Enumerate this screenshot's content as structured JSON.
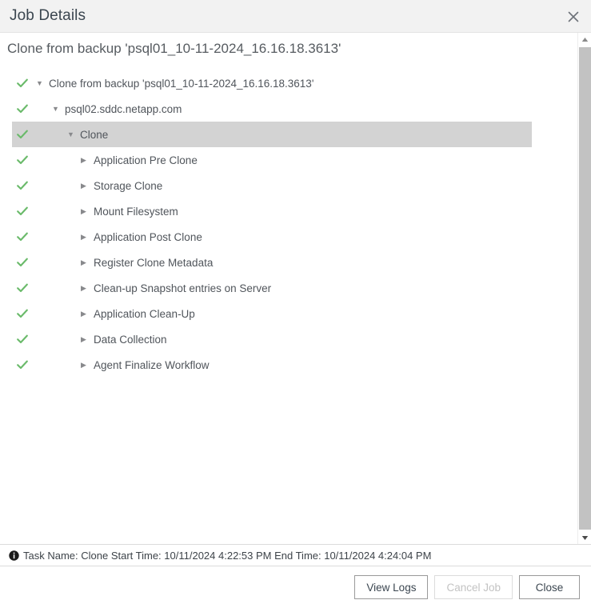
{
  "window": {
    "title": "Job Details",
    "close_icon": "close-icon"
  },
  "heading": "Clone from backup 'psql01_10-11-2024_16.16.18.3613'",
  "tree": {
    "nodes": [
      {
        "label": "Clone from backup 'psql01_10-11-2024_16.16.18.3613'",
        "level": 0,
        "twisty": "▼",
        "expanded": true,
        "status": "success",
        "selected": false
      },
      {
        "label": "psql02.sddc.netapp.com",
        "level": 1,
        "twisty": "▼",
        "expanded": true,
        "status": "success",
        "selected": false
      },
      {
        "label": "Clone",
        "level": 2,
        "twisty": "▼",
        "expanded": true,
        "status": "success",
        "selected": true
      },
      {
        "label": "Application Pre Clone",
        "level": 3,
        "twisty": "▶",
        "expanded": false,
        "status": "success",
        "selected": false
      },
      {
        "label": "Storage Clone",
        "level": 3,
        "twisty": "▶",
        "expanded": false,
        "status": "success",
        "selected": false
      },
      {
        "label": "Mount Filesystem",
        "level": 3,
        "twisty": "▶",
        "expanded": false,
        "status": "success",
        "selected": false
      },
      {
        "label": "Application Post Clone",
        "level": 3,
        "twisty": "▶",
        "expanded": false,
        "status": "success",
        "selected": false
      },
      {
        "label": "Register Clone Metadata",
        "level": 3,
        "twisty": "▶",
        "expanded": false,
        "status": "success",
        "selected": false
      },
      {
        "label": "Clean-up Snapshot entries on Server",
        "level": 3,
        "twisty": "▶",
        "expanded": false,
        "status": "success",
        "selected": false
      },
      {
        "label": "Application Clean-Up",
        "level": 3,
        "twisty": "▶",
        "expanded": false,
        "status": "success",
        "selected": false
      },
      {
        "label": "Data Collection",
        "level": 3,
        "twisty": "▶",
        "expanded": false,
        "status": "success",
        "selected": false
      },
      {
        "label": "Agent Finalize Workflow",
        "level": 3,
        "twisty": "▶",
        "expanded": false,
        "status": "success",
        "selected": false
      }
    ]
  },
  "scrollbar": {
    "up_arrow_icon": "chevron-up-icon",
    "down_arrow_icon": "chevron-down-icon"
  },
  "status": {
    "icon": "info-icon",
    "text": "Task Name: Clone Start Time: 10/11/2024 4:22:53 PM End Time: 10/11/2024 4:24:04 PM"
  },
  "footer": {
    "view_logs_label": "View Logs",
    "cancel_job_label": "Cancel Job",
    "close_label": "Close"
  },
  "colors": {
    "success_check": "#6aba6a",
    "selection": "#d3d3d3",
    "titlebar_bg": "#f2f2f2",
    "text": "#50555b"
  }
}
